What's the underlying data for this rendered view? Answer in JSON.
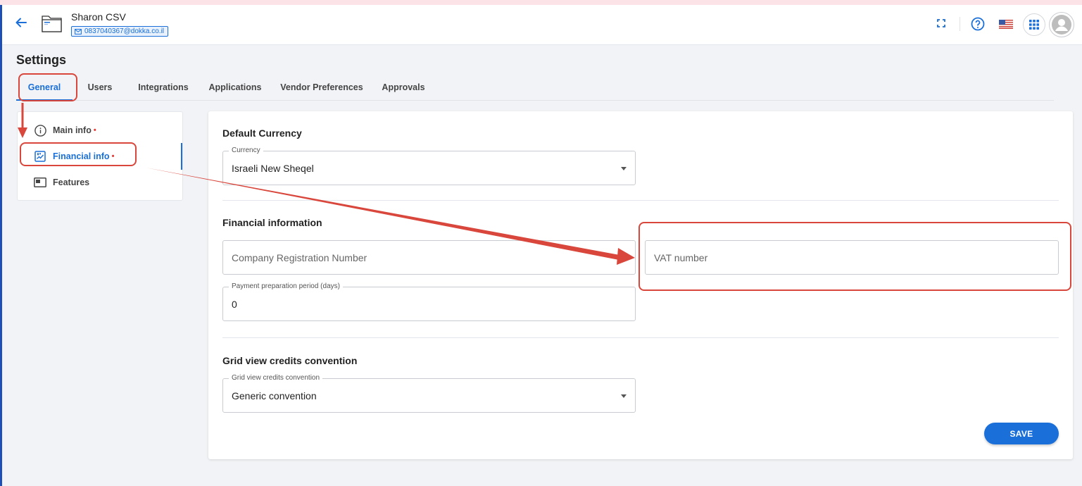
{
  "header": {
    "company_name": "Sharon CSV",
    "email": "0837040367@dokka.co.il"
  },
  "page": {
    "title": "Settings"
  },
  "tabs": [
    {
      "label": "General",
      "active": true
    },
    {
      "label": "Users",
      "active": false
    },
    {
      "label": "Integrations",
      "active": false
    },
    {
      "label": "Applications",
      "active": false
    },
    {
      "label": "Vendor Preferences",
      "active": false
    },
    {
      "label": "Approvals",
      "active": false
    }
  ],
  "sidebar": {
    "items": [
      {
        "label": "Main info",
        "icon": "info-icon",
        "required": true,
        "active": false
      },
      {
        "label": "Financial info",
        "icon": "financial-icon",
        "required": true,
        "active": true
      },
      {
        "label": "Features",
        "icon": "features-icon",
        "required": false,
        "active": false
      }
    ],
    "required_marker": "•"
  },
  "main": {
    "default_currency": {
      "title": "Default Currency",
      "currency_label": "Currency",
      "currency_value": "Israeli New Sheqel"
    },
    "financial_information": {
      "title": "Financial information",
      "company_reg_placeholder": "Company Registration Number",
      "vat_placeholder": "VAT number",
      "payment_period_label": "Payment preparation period (days)",
      "payment_period_value": "0"
    },
    "grid_view": {
      "title": "Grid view credits convention",
      "label": "Grid view credits convention",
      "value": "Generic convention"
    },
    "save_label": "SAVE"
  },
  "colors": {
    "accent": "#1a6fd8",
    "annotation": "#d9463b",
    "required_dot": "#e53935"
  }
}
